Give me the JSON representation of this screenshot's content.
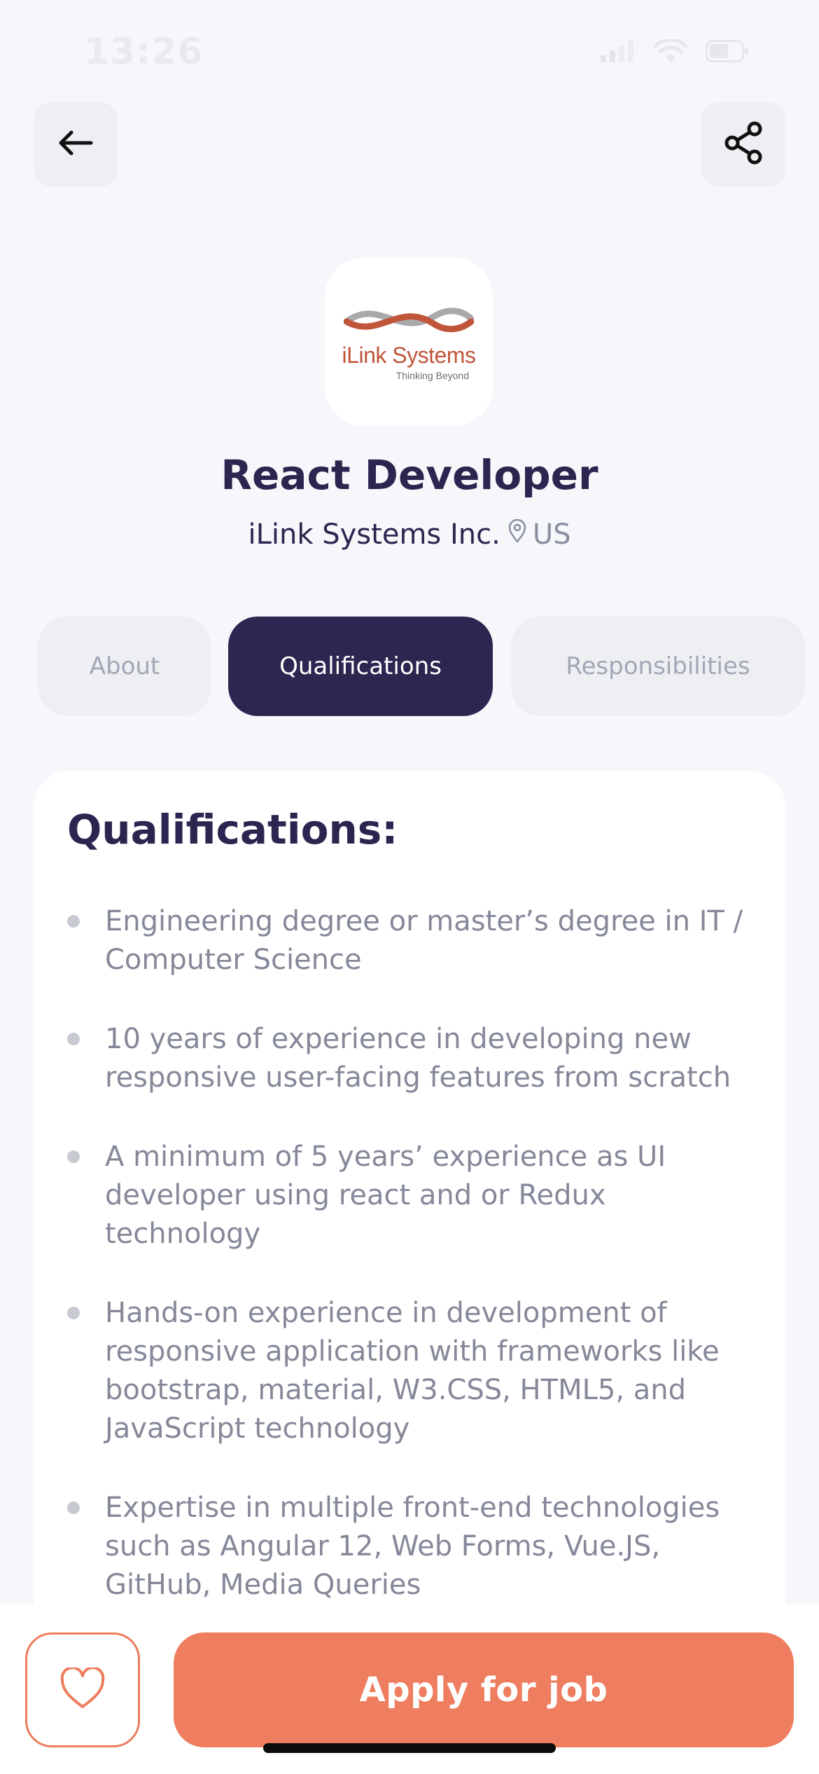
{
  "status_bar": {
    "time": "13:26"
  },
  "job": {
    "title": "React Developer",
    "company": "iLink Systems Inc.",
    "location": "US",
    "logo": {
      "name": "iLink Systems",
      "tagline": "Thinking Beyond"
    }
  },
  "tabs": [
    {
      "label": "About",
      "selected": false
    },
    {
      "label": "Qualifications",
      "selected": true
    },
    {
      "label": "Responsibilities",
      "selected": false
    }
  ],
  "qualifications": {
    "heading": "Qualifications:",
    "items": [
      "Engineering degree or master’s degree in IT / Computer Science",
      "10 years of experience in developing new responsive user-facing features from scratch",
      "A minimum of 5 years’ experience as UI developer using react and or Redux technology",
      "Hands-on experience in development of responsive application with frameworks like bootstrap, material, W3.CSS, HTML5, and JavaScript technology",
      "Expertise in multiple front-end technologies such as Angular 12, Web Forms, Vue.JS, GitHub, Media Queries"
    ]
  },
  "actions": {
    "apply_label": "Apply for job"
  },
  "colors": {
    "primary_dark": "#2D2650",
    "accent": "#EE7E5F",
    "background": "#F6F7FA"
  },
  "icons": [
    "back-arrow-icon",
    "share-icon",
    "location-pin-icon",
    "heart-icon",
    "signal-icon",
    "wifi-icon",
    "battery-icon"
  ]
}
